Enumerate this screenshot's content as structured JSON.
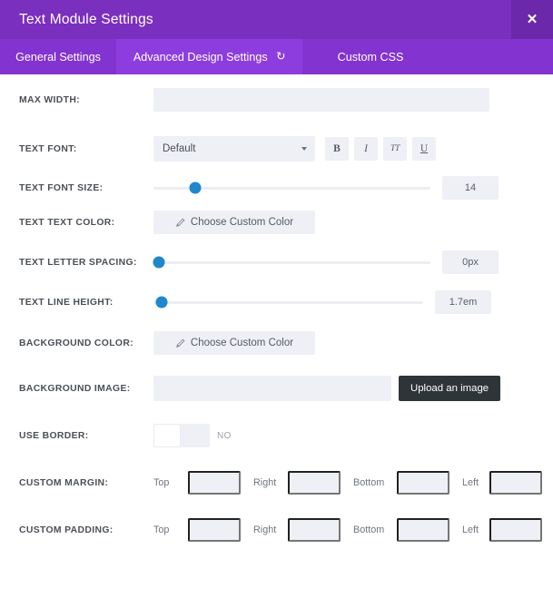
{
  "header": {
    "title": "Text Module Settings",
    "close_icon": "close-icon",
    "close_label": "✕",
    "bg_color": "#7b2fbe"
  },
  "tabs": [
    {
      "label": "General Settings",
      "active": false
    },
    {
      "label": "Advanced Design Settings",
      "active": true,
      "reset_icon": "↺"
    },
    {
      "label": "Custom CSS",
      "active": false
    }
  ],
  "fields": {
    "max_width": {
      "label": "MAX WIDTH:",
      "value": "",
      "placeholder": ""
    },
    "text_font": {
      "label": "TEXT FONT:",
      "value": "Default",
      "style_buttons": [
        {
          "name": "bold",
          "label": "B"
        },
        {
          "name": "italic",
          "label": "I"
        },
        {
          "name": "uppercase",
          "label": "TT"
        },
        {
          "name": "underline",
          "label": "U"
        }
      ]
    },
    "text_font_size": {
      "label": "TEXT FONT SIZE:",
      "value": "14",
      "thumb_percent": 15
    },
    "text_text_color": {
      "label": "TEXT TEXT COLOR:",
      "button_label": "Choose Custom Color",
      "icon": "pencil-icon"
    },
    "text_letter_spacing": {
      "label": "TEXT LETTER SPACING:",
      "value": "0px",
      "thumb_percent": 2
    },
    "text_line_height": {
      "label": "TEXT LINE HEIGHT:",
      "value": "1.7em",
      "thumb_percent": 3
    },
    "background_color": {
      "label": "BACKGROUND COLOR:",
      "button_label": "Choose Custom Color",
      "icon": "pencil-icon"
    },
    "background_image": {
      "label": "BACKGROUND IMAGE:",
      "value": "",
      "upload_label": "Upload an image"
    },
    "use_border": {
      "label": "USE BORDER:",
      "state_label": "NO",
      "on": false
    },
    "custom_margin": {
      "label": "CUSTOM MARGIN:",
      "sides": [
        {
          "label": "Top",
          "value": ""
        },
        {
          "label": "Right",
          "value": ""
        },
        {
          "label": "Bottom",
          "value": ""
        },
        {
          "label": "Left",
          "value": ""
        }
      ]
    },
    "custom_padding": {
      "label": "CUSTOM PADDING:",
      "sides": [
        {
          "label": "Top",
          "value": ""
        },
        {
          "label": "Right",
          "value": ""
        },
        {
          "label": "Bottom",
          "value": ""
        },
        {
          "label": "Left",
          "value": ""
        }
      ]
    }
  },
  "colors": {
    "header_purple": "#7b2fbe",
    "tabbar_purple": "#8333cf",
    "active_tab_purple": "#8d3ddd",
    "field_gray": "#eef0f5",
    "slider_blue": "#1f87ca",
    "upload_dark": "#2e3539"
  }
}
